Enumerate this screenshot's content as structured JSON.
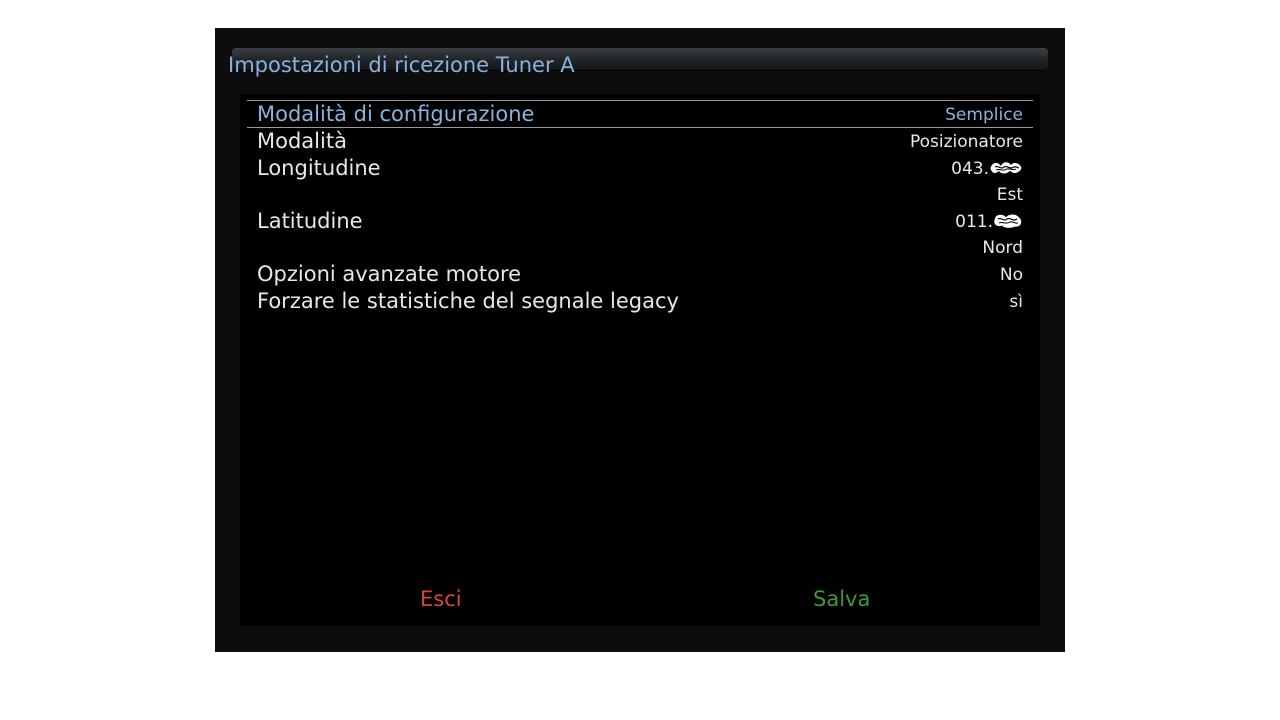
{
  "header": {
    "title": "Impostazioni di ricezione Tuner A"
  },
  "settings": {
    "mode_config": {
      "label": "Modalità di configurazione",
      "value": "Semplice"
    },
    "mode": {
      "label": "Modalità",
      "value": "Posizionatore"
    },
    "longitude": {
      "label": "Longitudine",
      "value_prefix": "043.",
      "direction": "Est"
    },
    "latitude": {
      "label": "Latitudine",
      "value_prefix": "011.",
      "direction": "Nord"
    },
    "motor_advanced": {
      "label": "Opzioni avanzate motore",
      "value": "No"
    },
    "legacy_stats": {
      "label": "Forzare le statistiche del segnale legacy",
      "value": "sì"
    }
  },
  "footer": {
    "exit_label": "Esci",
    "save_label": "Salva"
  },
  "colors": {
    "accent": "#8ab2e0",
    "exit": "#d9473a",
    "save": "#3f9a34",
    "text": "#e8e8e8",
    "panel": "#000000",
    "frame": "#0d0d0d"
  }
}
